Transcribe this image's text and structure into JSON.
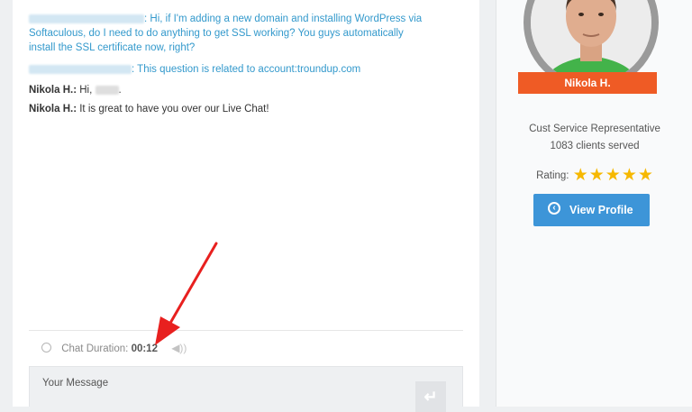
{
  "chat": {
    "messages": [
      {
        "text": ": Hi, if I'm adding a new domain and installing WordPress via"
      },
      {
        "text": "Softaculous, do I need to do anything to get SSL working? You guys automatically"
      },
      {
        "text": "install the SSL certificate now, right?"
      },
      {
        "text": ": This question is related to account:troundup.com"
      },
      {
        "name": "Nikola H.:",
        "text": " Hi,"
      },
      {
        "name": "Nikola H.:",
        "text": " It is great to have you over our Live Chat!"
      }
    ],
    "duration_label": "Chat Duration:",
    "duration_value": "00:12",
    "message_placeholder": "Your Message"
  },
  "profile": {
    "agent_name": "Nikola H.",
    "role": "Cust Service Representative",
    "clients_served": "1083 clients served",
    "rating_label": "Rating:",
    "rating_stars": 5,
    "view_profile_label": "View Profile"
  },
  "colors": {
    "link_blue": "#3399cc",
    "ribbon_orange": "#ef5b25",
    "button_blue": "#3d95d8",
    "star_gold": "#f6b800",
    "arrow_red": "#e8201f"
  }
}
